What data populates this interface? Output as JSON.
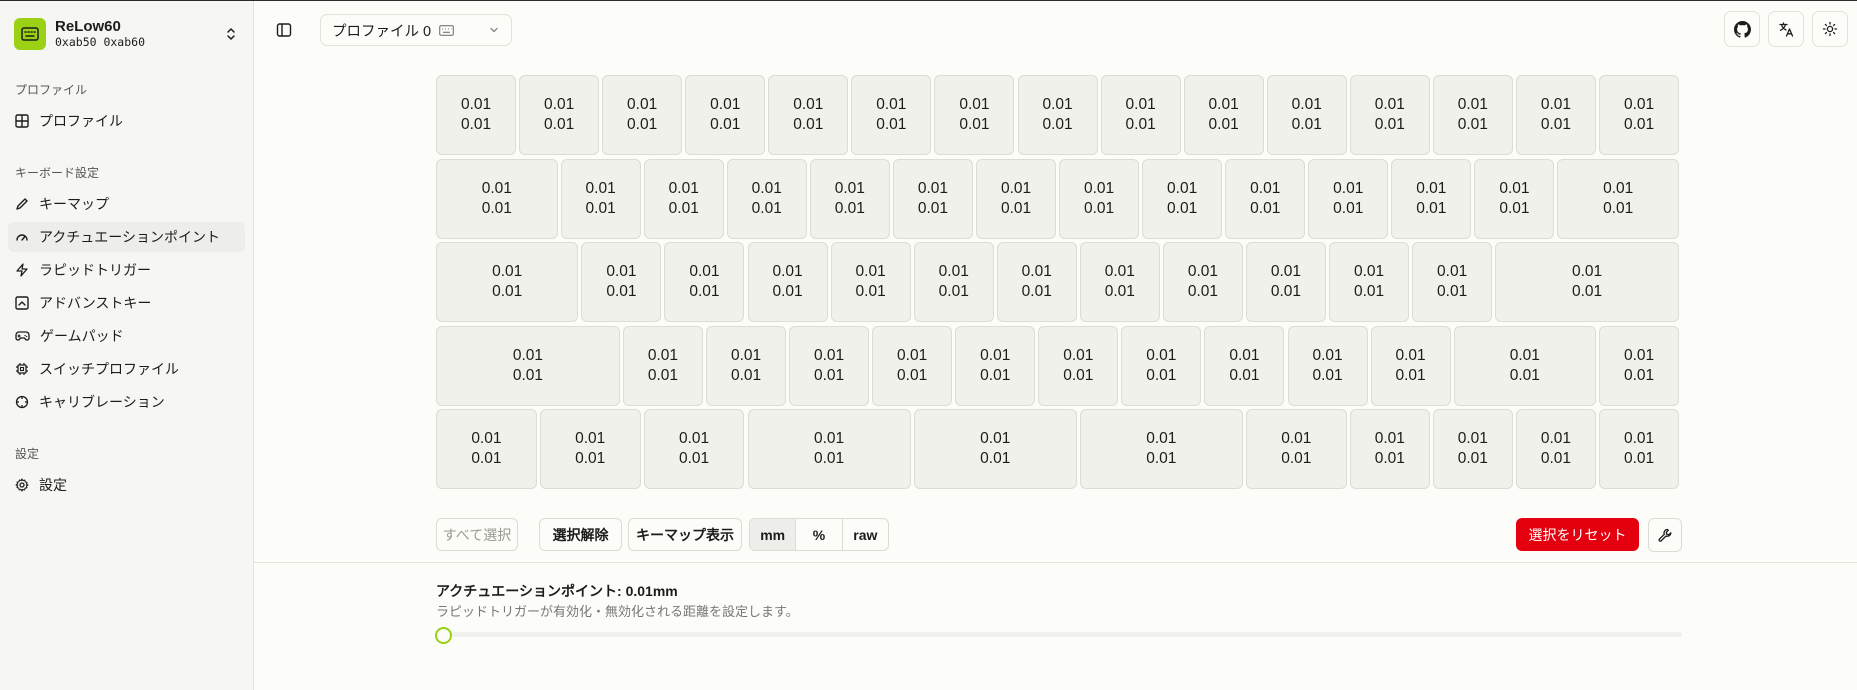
{
  "device": {
    "name": "ReLow60",
    "id": "0xab50 0xab60"
  },
  "sidebar": {
    "sections": [
      {
        "label": "プロファイル",
        "items": [
          {
            "label": "プロファイル",
            "icon": "grid-icon"
          }
        ]
      },
      {
        "label": "キーボード設定",
        "items": [
          {
            "label": "キーマップ",
            "icon": "pencil-icon"
          },
          {
            "label": "アクチュエーションポイント",
            "icon": "gauge-icon",
            "active": true
          },
          {
            "label": "ラピッドトリガー",
            "icon": "zap-icon"
          },
          {
            "label": "アドバンストキー",
            "icon": "square-chart-icon"
          },
          {
            "label": "ゲームパッド",
            "icon": "gamepad-icon"
          },
          {
            "label": "スイッチプロファイル",
            "icon": "chip-icon"
          },
          {
            "label": "キャリブレーション",
            "icon": "crosshair-icon"
          }
        ]
      },
      {
        "label": "設定",
        "items": [
          {
            "label": "設定",
            "icon": "gear-icon"
          }
        ]
      }
    ]
  },
  "header": {
    "profile": "プロファイル 0"
  },
  "keyboard": {
    "value_top": "0.01",
    "value_bottom": "0.01",
    "row_units": [
      [
        1,
        1,
        1,
        1,
        1,
        1,
        1,
        1,
        1,
        1,
        1,
        1,
        1,
        1,
        1
      ],
      [
        1.5,
        1,
        1,
        1,
        1,
        1,
        1,
        1,
        1,
        1,
        1,
        1,
        1,
        1.5
      ],
      [
        1.75,
        1,
        1,
        1,
        1,
        1,
        1,
        1,
        1,
        1,
        1,
        1,
        2.25
      ],
      [
        2.25,
        1,
        1,
        1,
        1,
        1,
        1,
        1,
        1,
        1,
        1,
        1.75,
        1
      ],
      [
        1.25,
        1.25,
        1.25,
        2,
        2,
        2,
        1.25,
        1,
        1,
        1,
        1
      ]
    ]
  },
  "toolbar": {
    "select_all": "すべて選択",
    "deselect": "選択解除",
    "show_keymap": "キーマップ表示",
    "units": [
      "mm",
      "%",
      "raw"
    ],
    "active_unit": "mm",
    "reset": "選択をリセット"
  },
  "actuation": {
    "title": "アクチュエーションポイント: 0.01mm",
    "description": "ラピッドトリガーが有効化・無効化される距離を設定します。",
    "slider_value": 0
  },
  "colors": {
    "accent": "#9ad114",
    "danger": "#e5000f"
  }
}
